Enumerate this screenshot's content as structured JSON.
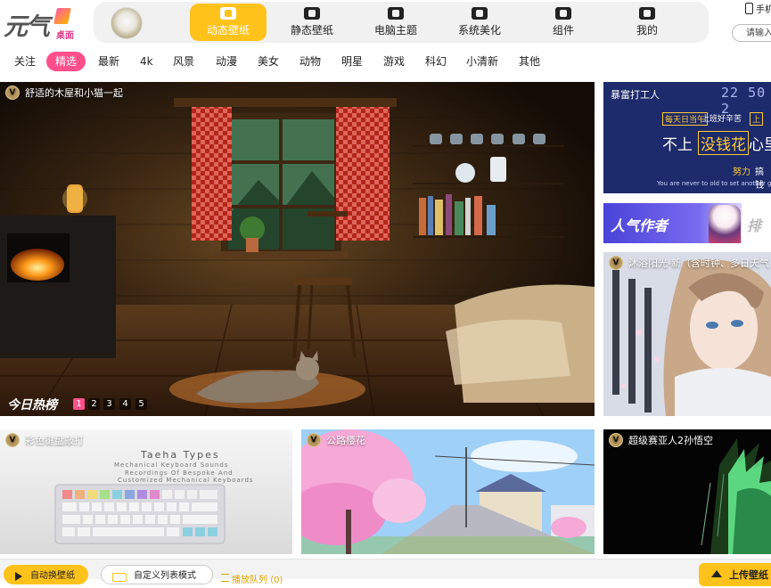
{
  "logo": {
    "text": "元气",
    "sub": "桌面"
  },
  "nav": {
    "tabs": [
      {
        "label": "动态壁纸",
        "icon": "video-icon",
        "active": true
      },
      {
        "label": "静态壁纸",
        "icon": "image-icon",
        "active": false
      },
      {
        "label": "电脑主题",
        "icon": "shirt-icon",
        "active": false
      },
      {
        "label": "系统美化",
        "icon": "flower-icon",
        "active": false
      },
      {
        "label": "组件",
        "icon": "widget-icon",
        "active": false
      },
      {
        "label": "我的",
        "icon": "user-card-icon",
        "active": false
      }
    ]
  },
  "header_right": {
    "phone_label": "手机",
    "invite_label": "请输入"
  },
  "categories": {
    "items": [
      "关注",
      "精选",
      "最新",
      "4k",
      "风景",
      "动漫",
      "美女",
      "动物",
      "明星",
      "游戏",
      "科幻",
      "小清新",
      "其他"
    ],
    "active_index": 1
  },
  "hero": {
    "title": "舒适的木屋和小猫一起",
    "hot_label": "今日热榜",
    "pages": [
      "1",
      "2",
      "3",
      "4",
      "5"
    ],
    "active_page": 0
  },
  "banner_rich": {
    "title": "暴富打工人",
    "clock": "22 50 2",
    "tag1": "每天日当午",
    "tag2": "上班好辛苦",
    "tag3": "上",
    "big1": "不上",
    "big2": "没钱花",
    "big3": "心里",
    "small1": "努力",
    "small2": "搞钱",
    "en": "You are never to old to set another goal"
  },
  "banner_author": {
    "text": "人气作者",
    "rank_text": "排"
  },
  "card_girl": {
    "title": "沐浴阳光-新（含时钟、多日天气"
  },
  "card_keyboard": {
    "title": "彩色键盘敲打",
    "brand": "Taeha Types",
    "sub1": "Mechanical Keyboard Sounds",
    "sub2": "Recordings Of Bespoke And",
    "sub3": "Customized Mechanical Keyboards"
  },
  "card_sakura": {
    "title": "公路樱花"
  },
  "card_goku": {
    "title": "超级赛亚人2孙悟空"
  },
  "footer": {
    "auto_label": "自动换壁纸",
    "custom_label": "自定义列表模式",
    "queue_label": "播放队列",
    "queue_count": "(0)",
    "upload_label": "上传壁纸"
  },
  "colors": {
    "accent": "#ffc21a",
    "pink": "#ff4f8b"
  }
}
